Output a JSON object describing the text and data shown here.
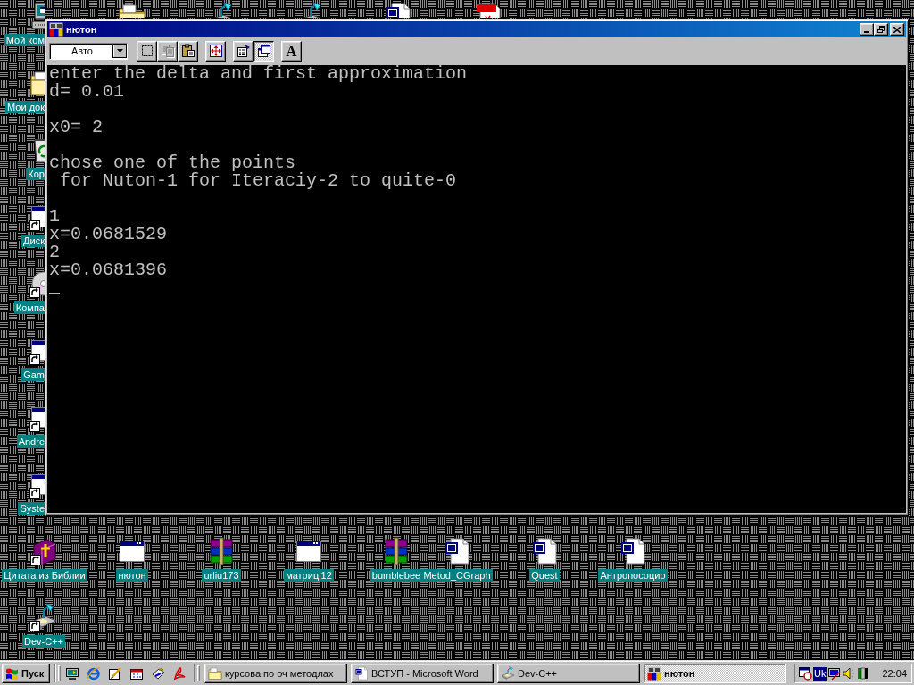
{
  "desktop": {
    "left_icons": [
      {
        "label": "Мой ком",
        "kind": "computer",
        "shortcut": false
      },
      {
        "label": "Мои док",
        "kind": "folder",
        "shortcut": false
      },
      {
        "label": "Кор",
        "kind": "recycle",
        "shortcut": false
      },
      {
        "label": "Диск",
        "kind": "window",
        "shortcut": true
      },
      {
        "label": "Компа",
        "kind": "disc",
        "shortcut": true
      },
      {
        "label": "Gam",
        "kind": "window",
        "shortcut": true
      },
      {
        "label": "Andre",
        "kind": "window",
        "shortcut": true
      },
      {
        "label": "Syste",
        "kind": "window",
        "shortcut": true
      }
    ],
    "bottom_icons": [
      {
        "label": "Цитата из Библии",
        "kind": "book",
        "shortcut": true
      },
      {
        "label": "нютон",
        "kind": "window",
        "shortcut": false
      },
      {
        "label": "urliu173",
        "kind": "archive",
        "shortcut": false
      },
      {
        "label": "матриці12",
        "kind": "window",
        "shortcut": false
      },
      {
        "label": "bumblebee",
        "kind": "archive",
        "shortcut": false
      },
      {
        "label": "Metod_CGraph",
        "kind": "document",
        "shortcut": false
      },
      {
        "label": "Quest",
        "kind": "document",
        "shortcut": false
      },
      {
        "label": "Антропосоцио",
        "kind": "document",
        "shortcut": false
      },
      {
        "label": "Dev-C++",
        "kind": "compiler",
        "shortcut": true
      }
    ]
  },
  "window": {
    "title": "нютон",
    "toolbar": {
      "font_size": "Авто",
      "buttons": [
        {
          "kind": "mark",
          "disabled": false,
          "pressed": false
        },
        {
          "kind": "copy",
          "disabled": true,
          "pressed": false
        },
        {
          "kind": "paste",
          "disabled": false,
          "pressed": false
        },
        {
          "kind": "fullscreen",
          "disabled": false,
          "pressed": false
        },
        {
          "kind": "properties",
          "disabled": false,
          "pressed": false
        },
        {
          "kind": "background",
          "disabled": false,
          "pressed": true
        },
        {
          "kind": "font",
          "glyph": "A",
          "disabled": false,
          "pressed": false
        }
      ]
    },
    "console": {
      "blocks": [
        [
          "enter the delta and first approximation",
          "d= 0.01"
        ],
        [
          "x0= 2"
        ],
        [
          "chose one of the points",
          " for Nuton-1 for Iteraciy-2 to quite-0"
        ],
        [
          "1",
          "x=0.0681529",
          "2",
          "x=0.0681396"
        ]
      ],
      "cursor": "_"
    }
  },
  "taskbar": {
    "start_button": "Пуск",
    "tasks": [
      {
        "label": "курсова по оч методлах",
        "kind": "folder",
        "selected": false
      },
      {
        "label": "ВСТУП - Microsoft Word",
        "kind": "document",
        "selected": false
      },
      {
        "label": "Dev-C++",
        "kind": "compiler",
        "selected": false
      },
      {
        "label": "нютон",
        "kind": "console",
        "selected": true
      }
    ],
    "tray": {
      "language": "Uk",
      "clock": "22:04"
    }
  }
}
